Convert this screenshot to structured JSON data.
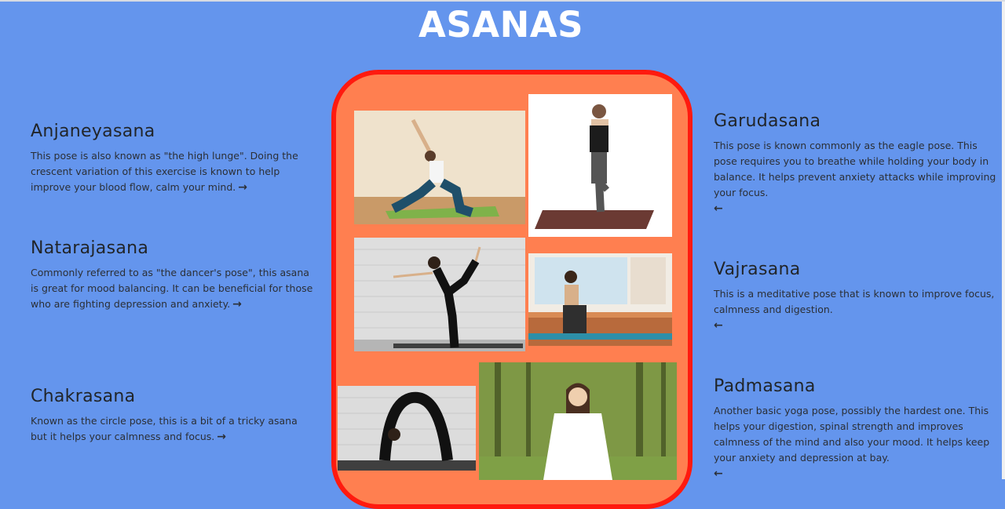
{
  "page": {
    "title": "ASANAS"
  },
  "left_asanas": [
    {
      "name": "Anjaneyasana",
      "description": "This pose is also known as \"the high lunge\". Doing the crescent variation of this exercise is known to help improve your blood flow, calm your mind.",
      "arrow": "→"
    },
    {
      "name": "Natarajasana",
      "description": "Commonly referred to as \"the dancer's pose\", this asana is great for mood balancing. It can be beneficial for those who are fighting depression and anxiety.",
      "arrow": "→"
    },
    {
      "name": "Chakrasana",
      "description": "Known as the circle pose, this is a bit of a tricky asana but it helps your calmness and focus.",
      "arrow": "→"
    }
  ],
  "right_asanas": [
    {
      "name": "Garudasana",
      "description": "This pose is known commonly as the eagle pose. This pose requires you to breathe while holding your body in balance. It helps prevent anxiety attacks while improving your focus.",
      "arrow": "←"
    },
    {
      "name": "Vajrasana",
      "description": "This is a meditative pose that is known to improve focus, calmness and digestion.",
      "arrow": "←"
    },
    {
      "name": "Padmasana",
      "description": "Another basic yoga pose, possibly the hardest one. This helps your digestion, spinal strength and improves calmness of the mind and also your mood. It helps keep your anxiety and depression at bay.",
      "arrow": "←"
    }
  ],
  "colors": {
    "background": "#6495ED",
    "panel": "#FF7F50",
    "panel_border": "#FF1A0F",
    "title": "#FFFFFF"
  },
  "images": [
    {
      "name": "anjaneyasana-photo"
    },
    {
      "name": "garudasana-photo"
    },
    {
      "name": "natarajasana-photo"
    },
    {
      "name": "vajrasana-photo"
    },
    {
      "name": "chakrasana-photo"
    },
    {
      "name": "padmasana-photo"
    }
  ]
}
